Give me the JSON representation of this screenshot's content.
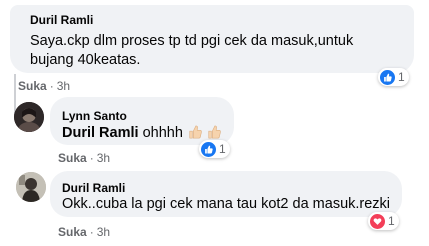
{
  "comments": [
    {
      "author": "Duril Ramli",
      "text_line1": "Saya.ckp dlm proses tp td pgi cek da masuk,untuk",
      "text_line2": "bujang 40keatas.",
      "like_label": "Suka",
      "time": "3h",
      "reaction_icon": "like-icon",
      "reaction_count": "1"
    },
    {
      "author": "Lynn Santo",
      "mention": "Duril Ramli",
      "text": "ohhhh",
      "emojis": [
        "thumbs-up-light-skin",
        "thumbs-up-light-skin"
      ],
      "like_label": "Suka",
      "time": "3h",
      "reaction_icon": "like-icon",
      "reaction_count": "1"
    },
    {
      "author": "Duril Ramli",
      "text": "Okk..cuba la pgi cek mana tau kot2 da masuk.rezki",
      "like_label": "Suka",
      "time": "3h",
      "reaction_icon": "love-icon",
      "reaction_count": "1"
    }
  ],
  "colors": {
    "bubble": "#f0f2f5",
    "like_blue": "#1877f2",
    "love_red": "#f33e58",
    "meta_gray": "#65676b"
  }
}
